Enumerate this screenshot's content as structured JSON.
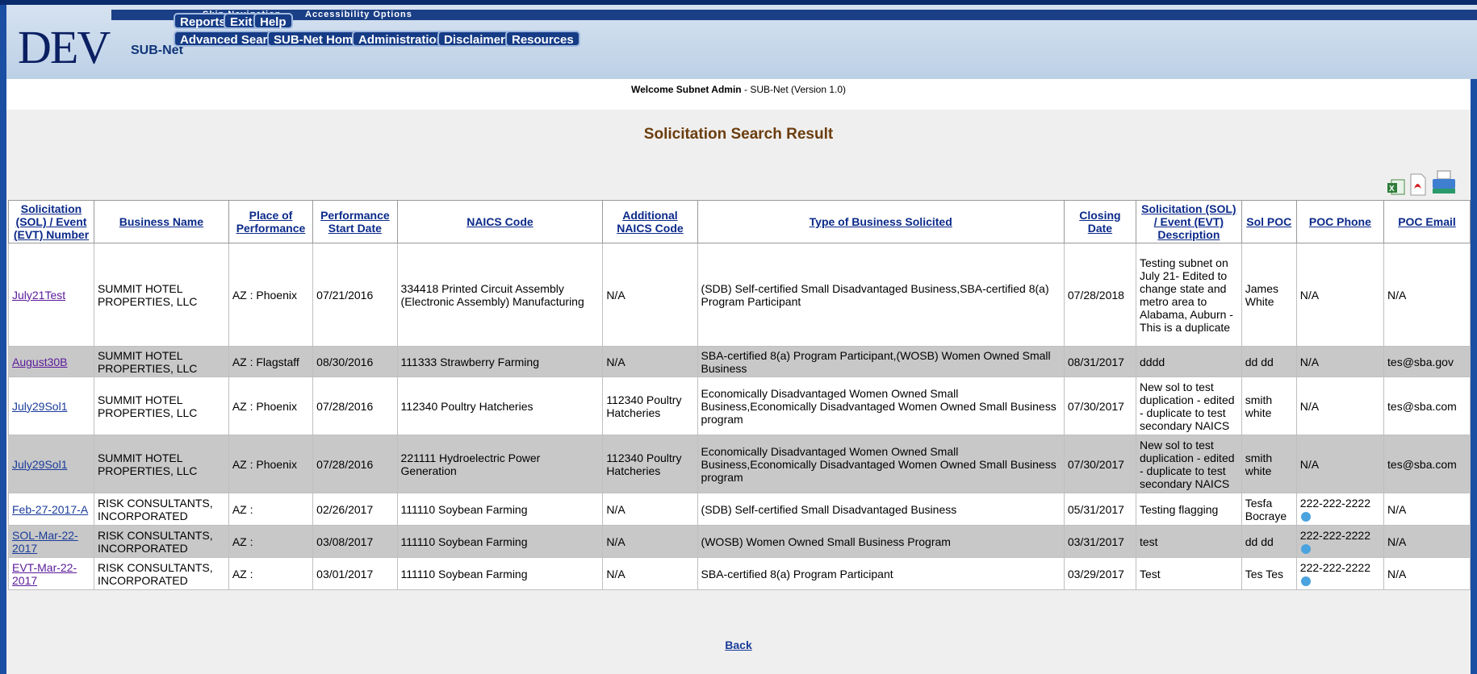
{
  "header": {
    "logo": "DEV",
    "app_name": "SUB-Net",
    "skip_navigation": "Skip Navigation",
    "accessibility": "Accessibility Options",
    "nav_top": [
      "Reports",
      "Exit",
      "Help"
    ],
    "nav_main": [
      "Advanced Search",
      "SUB-Net Home",
      "Administration",
      "Disclaimers",
      "Resources"
    ]
  },
  "welcome": {
    "greeting": "Welcome Subnet Admin",
    "version": " - SUB-Net (Version 1.0)"
  },
  "page_title": "Solicitation Search Result",
  "export_icons": [
    "excel-icon",
    "pdf-icon",
    "print-icon"
  ],
  "table": {
    "headers": [
      "Solicitation (SOL) / Event (EVT) Number",
      "Business Name",
      "Place of Performance",
      "Performance Start Date",
      "NAICS Code",
      "Additional NAICS Code",
      "Type of Business Solicited",
      "Closing Date",
      "Solicitation (SOL) / Event (EVT) Description",
      "Sol POC",
      "POC Phone",
      "POC Email"
    ],
    "rows": [
      {
        "id": "July21Test",
        "business": "SUMMIT HOTEL PROPERTIES, LLC",
        "place": "AZ : Phoenix",
        "start": "07/21/2016",
        "naics": "334418 Printed Circuit Assembly (Electronic Assembly) Manufacturing",
        "add_naics": "N/A",
        "type": "(SDB) Self-certified Small Disadvantaged Business,SBA-certified 8(a) Program Participant",
        "closing": "07/28/2018",
        "desc": "Testing subnet on July 21- Edited to change state and metro area to Alabama, Auburn - This is a duplicate",
        "poc": "James White",
        "phone": "N/A",
        "email": "N/A"
      },
      {
        "id": "August30B",
        "business": "SUMMIT HOTEL PROPERTIES, LLC",
        "place": "AZ : Flagstaff",
        "start": "08/30/2016",
        "naics": "111333 Strawberry Farming",
        "add_naics": "N/A",
        "type": "SBA-certified 8(a) Program Participant,(WOSB) Women Owned Small Business",
        "closing": "08/31/2017",
        "desc": "dddd",
        "poc": "dd dd",
        "phone": "N/A",
        "email": "tes@sba.gov"
      },
      {
        "id": "July29Sol1",
        "business": "SUMMIT HOTEL PROPERTIES, LLC",
        "place": "AZ : Phoenix",
        "start": "07/28/2016",
        "naics": "112340 Poultry Hatcheries",
        "add_naics": "112340 Poultry Hatcheries",
        "type": "Economically Disadvantaged Women Owned Small Business,Economically Disadvantaged Women Owned Small Business program",
        "closing": "07/30/2017",
        "desc": "New sol to test duplication - edited - duplicate to test secondary NAICS",
        "poc": "smith white",
        "phone": "N/A",
        "email": "tes@sba.com"
      },
      {
        "id": "July29Sol1",
        "business": "SUMMIT HOTEL PROPERTIES, LLC",
        "place": "AZ : Phoenix",
        "start": "07/28/2016",
        "naics": "221111 Hydroelectric Power Generation",
        "add_naics": "112340 Poultry Hatcheries",
        "type": "Economically Disadvantaged Women Owned Small Business,Economically Disadvantaged Women Owned Small Business program",
        "closing": "07/30/2017",
        "desc": "New sol to test duplication - edited - duplicate to test secondary NAICS",
        "poc": "smith white",
        "phone": "N/A",
        "email": "tes@sba.com"
      },
      {
        "id": "Feb-27-2017-A",
        "business": "RISK CONSULTANTS, INCORPORATED",
        "place": "AZ :",
        "start": "02/26/2017",
        "naics": "111110 Soybean Farming",
        "add_naics": "N/A",
        "type": "(SDB) Self-certified Small Disadvantaged Business",
        "closing": "05/31/2017",
        "desc": "Testing flagging",
        "poc": "Tesfa Bocraye",
        "phone": "222-222-2222",
        "email": "N/A"
      },
      {
        "id": "SOL-Mar-22-2017",
        "business": "RISK CONSULTANTS, INCORPORATED",
        "place": "AZ :",
        "start": "03/08/2017",
        "naics": "111110 Soybean Farming",
        "add_naics": "N/A",
        "type": "(WOSB) Women Owned Small Business Program",
        "closing": "03/31/2017",
        "desc": "test",
        "poc": "dd dd",
        "phone": "222-222-2222",
        "email": "N/A"
      },
      {
        "id": "EVT-Mar-22-2017",
        "business": "RISK CONSULTANTS, INCORPORATED",
        "place": "AZ :",
        "start": "03/01/2017",
        "naics": "111110 Soybean Farming",
        "add_naics": "N/A",
        "type": "SBA-certified 8(a) Program Participant",
        "closing": "03/29/2017",
        "desc": "Test",
        "poc": "Tes Tes",
        "phone": "222-222-2222",
        "email": "N/A"
      }
    ]
  },
  "back_link": "Back"
}
